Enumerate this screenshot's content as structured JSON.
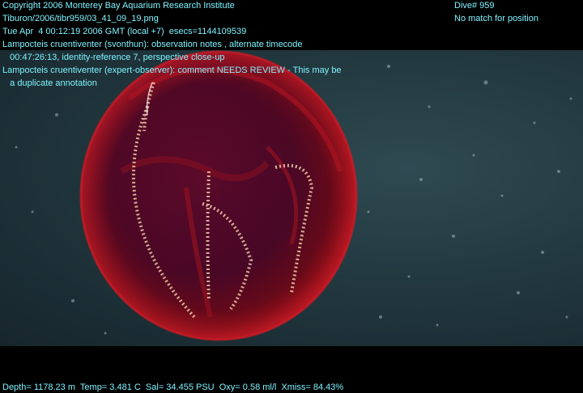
{
  "overlay": {
    "copyright": "Copyright 2006 Monterey Bay Aquarium Research Institute",
    "file_path": "Tiburon/2006/tibr959/03_41_09_19.png",
    "timestamp": "Tue Apr  4 00:12:19 2006 GMT (local +7)  esecs=1144109539",
    "annotation_1_line_1": "Lampocteis cruentiventer (svonthun): observation notes , alternate timecode",
    "annotation_1_line_2": "   00:47:26:13, identity-reference 7, perspective close-up",
    "annotation_2_line_1": "Lampocteis cruentiventer (expert-observer): comment NEEDS REVIEW - This may be",
    "annotation_2_line_2": "   a duplicate annotation",
    "dive": "Dive# 959",
    "position": "No match for position",
    "sensor_readout": "Depth= 1178.23 m  Temp= 3.481 C  Sal= 34.455 PSU  Oxy= 0.58 ml/l  Xmiss= 84.43%"
  },
  "colors": {
    "overlay_text": "#7ef3ff",
    "water": "#22383f",
    "animal_red": "#b3121f"
  }
}
